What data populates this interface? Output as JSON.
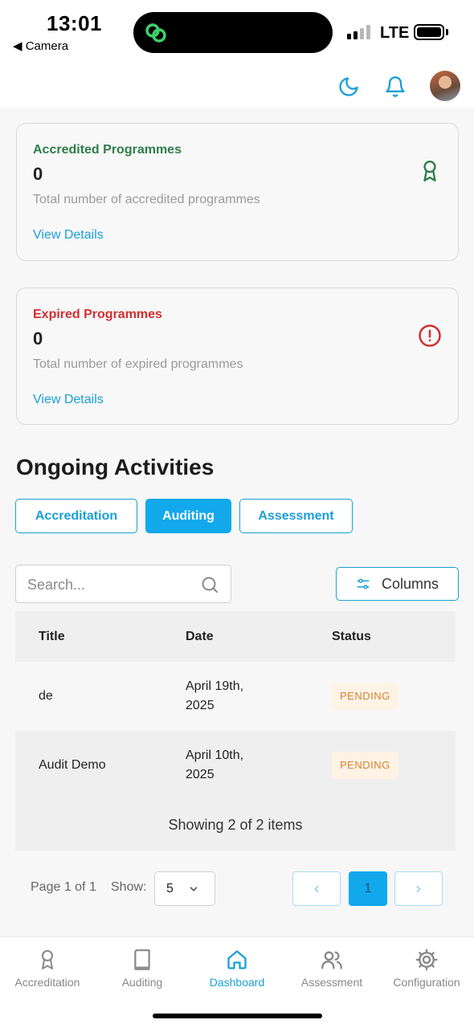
{
  "status_bar": {
    "time": "13:01",
    "back_label": "◀ Camera",
    "network": "LTE"
  },
  "header": {
    "icons": [
      "moon-icon",
      "bell-icon",
      "avatar"
    ]
  },
  "cards": [
    {
      "title": "Accredited Programmes",
      "count": "0",
      "description": "Total number of accredited programmes",
      "link": "View Details",
      "color": "#2e7d4a",
      "icon": "award-icon"
    },
    {
      "title": "Expired Programmes",
      "count": "0",
      "description": "Total number of expired programmes",
      "link": "View Details",
      "color": "#d32f2f",
      "icon": "alert-circle-icon"
    }
  ],
  "activities": {
    "title": "Ongoing Activities",
    "tabs": [
      {
        "label": "Accreditation",
        "active": false
      },
      {
        "label": "Auditing",
        "active": true
      },
      {
        "label": "Assessment",
        "active": false
      }
    ],
    "search_placeholder": "Search...",
    "columns_label": "Columns",
    "table": {
      "headers": [
        "Title",
        "Date",
        "Status"
      ],
      "rows": [
        {
          "title": "de",
          "date": "April 19th, 2025",
          "status": "PENDING"
        },
        {
          "title": "Audit Demo",
          "date": "April 10th, 2025",
          "status": "PENDING"
        }
      ],
      "footer": "Showing 2 of 2 items"
    },
    "pagination": {
      "page_info": "Page 1 of 1",
      "show_label": "Show:",
      "page_size": "5",
      "current_page": "1"
    }
  },
  "bottom_nav": [
    {
      "label": "Accreditation",
      "icon": "award-icon",
      "active": false
    },
    {
      "label": "Auditing",
      "icon": "book-icon",
      "active": false
    },
    {
      "label": "Dashboard",
      "icon": "home-icon",
      "active": true
    },
    {
      "label": "Assessment",
      "icon": "users-icon",
      "active": false
    },
    {
      "label": "Configuration",
      "icon": "gear-icon",
      "active": false
    }
  ],
  "colors": {
    "accent": "#1a9fd6",
    "active_tab": "#12a8ec",
    "pending_text": "#d9822b",
    "pending_bg": "#fff3e6"
  }
}
